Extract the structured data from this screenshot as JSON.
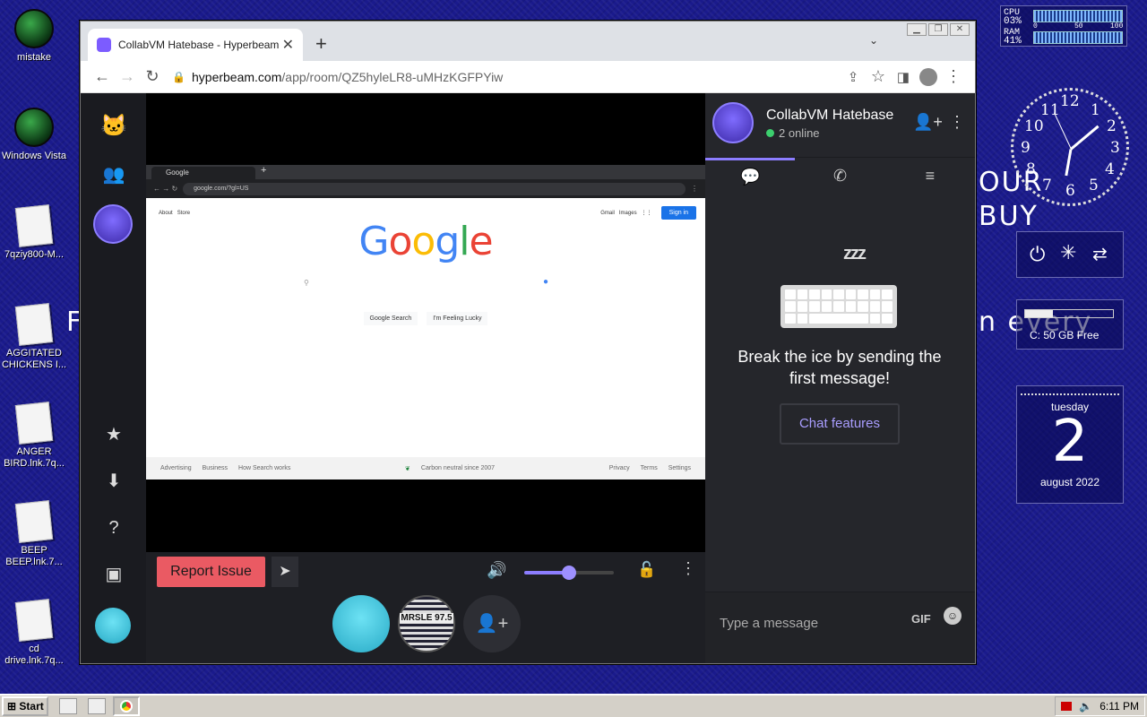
{
  "desktop": {
    "icons": [
      {
        "label": "mistake"
      },
      {
        "label": "Windows Vista"
      },
      {
        "label": "7qziy800-M..."
      },
      {
        "label": "AGGITATED CHICKENS I..."
      },
      {
        "label": "ANGER BIRD.lnk.7q..."
      },
      {
        "label": "BEEP BEEP.lnk.7..."
      },
      {
        "label": "cd drive.lnk.7q..."
      }
    ],
    "bg_text_left": "F",
    "bg_text_right1": "OUR",
    "bg_text_right2": "BUY",
    "bg_text_right3": "n every"
  },
  "gadgets": {
    "cpu_label": "CPU",
    "cpu_value": "03%",
    "ram_label": "RAM",
    "ram_value": "41%",
    "scale": [
      "0",
      "50",
      "100"
    ],
    "drive": "C: 50 GB Free",
    "calendar_day": "tuesday",
    "calendar_date": "2",
    "calendar_month": "august 2022",
    "clock_numbers": [
      "12",
      "1",
      "2",
      "3",
      "4",
      "5",
      "6",
      "7",
      "8",
      "9",
      "10",
      "11"
    ]
  },
  "browser": {
    "tab_title": "CollabVM Hatebase - Hyperbeam",
    "url_host": "hyperbeam.com",
    "url_path": "/app/room/QZ5hyleLR8-uMHzKGFPYiw"
  },
  "inner_browser": {
    "tab_title": "Google",
    "url": "google.com/?gl=US",
    "top_left": [
      "About",
      "Store"
    ],
    "top_right": [
      "Gmail",
      "Images"
    ],
    "signin": "Sign in",
    "search_btn": "Google Search",
    "lucky_btn": "I'm Feeling Lucky",
    "footer_left": [
      "Advertising",
      "Business",
      "How Search works"
    ],
    "footer_center": "Carbon neutral since 2007",
    "footer_right": [
      "Privacy",
      "Terms",
      "Settings"
    ]
  },
  "controls": {
    "report_label": "Report Issue",
    "volume_level": 0.5
  },
  "participants": {
    "mrsle_text": "MRSLE 97.5"
  },
  "chat": {
    "room_name": "CollabVM Hatebase",
    "online": "2 online",
    "zzz": "zzz",
    "empty_message": "Break the ice by sending the first message!",
    "features_button": "Chat features",
    "input_placeholder": "Type a message",
    "gif_label": "GIF"
  },
  "taskbar": {
    "start_label": "Start",
    "time": "6:11 PM"
  },
  "colors": {
    "accent": "#8c7dff",
    "report": "#ea5a63",
    "online": "#3ccf6e"
  }
}
